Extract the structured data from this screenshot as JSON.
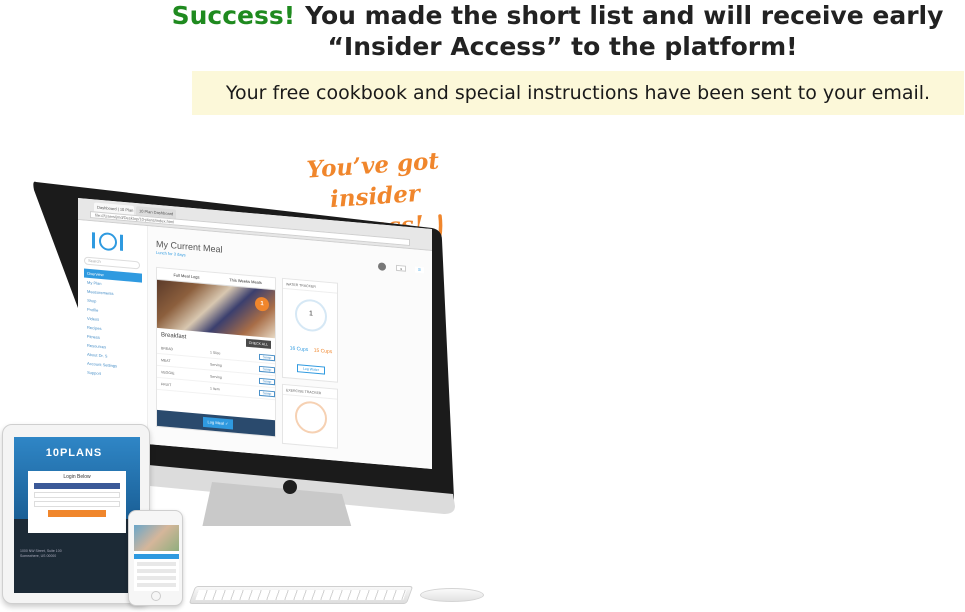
{
  "headline": {
    "success": "Success!",
    "line1": "You made the short list and will receive early",
    "line2": "“Insider Access” to the platform!"
  },
  "notice": "Your free cookbook and special instructions have been sent to your email.",
  "callout": {
    "line1": "You’ve got",
    "line2": "insider access!",
    "color": "#f0862c"
  },
  "colors": {
    "success": "#1f8a1f",
    "notice_bg": "#fcf8d9",
    "brand_blue": "#2f9ae0",
    "accent_orange": "#f0862c"
  },
  "imac_screen": {
    "browser": {
      "tabs": [
        "Dashboard | 10 Plan",
        "10 Plan Dashboard"
      ],
      "url": "file:///Users/jmd/Desktop/10-plans/index.html"
    },
    "sidebar": {
      "search_placeholder": "Search",
      "items": [
        "Overview",
        "My Plan",
        "Measurements",
        "Shop",
        "Profile",
        "Videos",
        "Recipes",
        "Fitness",
        "Resources",
        "About Dr. S",
        "Account Settings",
        "Support"
      ]
    },
    "page_title": "My Current Meal",
    "page_sub": "Lunch for 3 days",
    "meal_tabs": [
      "Full Meal Logs",
      "This Weeks Meals"
    ],
    "meal_badge": "1",
    "meal_name": "Breakfast",
    "check_all": "CHECK ALL",
    "food_rows": [
      {
        "name": "BREAD",
        "qty": "1 Slice",
        "swap": "Swap"
      },
      {
        "name": "MEAT",
        "qty": "Serving",
        "swap": "Swap"
      },
      {
        "name": "VEGGIE",
        "qty": "Serving",
        "swap": "Swap"
      },
      {
        "name": "FRUIT",
        "qty": "1 Item",
        "swap": "Swap"
      }
    ],
    "log_meal": "Log Meal ✓",
    "water": {
      "header": "WATER TRACKER",
      "count": "1",
      "cups_done": "16 Cups",
      "cups_left": "15 Cups",
      "button": "Log Water"
    },
    "exercise_header": "EXERCISE TRACKER"
  },
  "ipad": {
    "logo": "10PLANS",
    "title": "Login Below",
    "foot_lines": [
      "1000 NW Street, Suite 100",
      "Somewhere, US 00000"
    ]
  }
}
